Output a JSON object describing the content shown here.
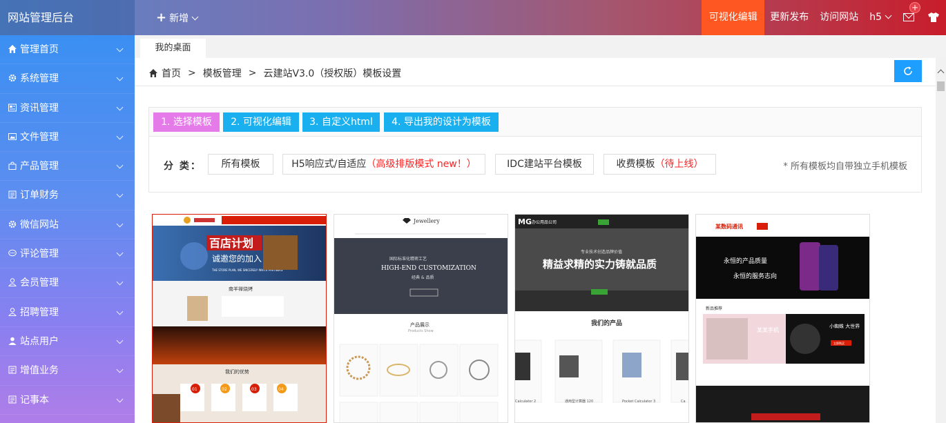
{
  "brand": "网站管理后台",
  "topbar": {
    "new_label": "新增",
    "visual_edit": "可视化编辑",
    "publish": "更新发布",
    "visit": "访问网站",
    "h5": "h5",
    "mail_badge": "+"
  },
  "sidebar": {
    "items": [
      {
        "label": "管理首页",
        "icon": "home-icon"
      },
      {
        "label": "系统管理",
        "icon": "gear-icon"
      },
      {
        "label": "资讯管理",
        "icon": "news-icon"
      },
      {
        "label": "文件管理",
        "icon": "image-icon"
      },
      {
        "label": "产品管理",
        "icon": "bag-icon"
      },
      {
        "label": "订单财务",
        "icon": "order-icon"
      },
      {
        "label": "微信网站",
        "icon": "gear-icon"
      },
      {
        "label": "评论管理",
        "icon": "comment-icon"
      },
      {
        "label": "会员管理",
        "icon": "user-icon"
      },
      {
        "label": "招聘管理",
        "icon": "user-icon"
      },
      {
        "label": "站点用户",
        "icon": "person-icon"
      },
      {
        "label": "增值业务",
        "icon": "order-icon"
      },
      {
        "label": "记事本",
        "icon": "order-icon"
      }
    ]
  },
  "tabs": {
    "desktop": "我的桌面"
  },
  "breadcrumb": {
    "home": "首页",
    "sep": ">",
    "level1": "模板管理",
    "level2": "云建站V3.0（授权版）模板设置"
  },
  "steps": {
    "s1": "1. 选择模板",
    "s2": "2. 可视化编辑",
    "s3": "3. 自定义html",
    "s4": "4. 导出我的设计为模板"
  },
  "categories": {
    "label": "分 类：",
    "all": "所有模板",
    "h5": "H5响应式/自适应",
    "h5_note": "（高级排版模式 new！）",
    "idc": "IDC建站平台模板",
    "paid": "收费模板",
    "paid_note": "（待上线）",
    "note": "* 所有模板均自带独立手机模板"
  },
  "templates": [
    {
      "hero": "百店计划",
      "hero_sub": "诚邀您的加入",
      "hero_en": "THE STORE PLAN, WE SINCERELY INVITE PARTNERS",
      "section_title": "南羊禅烧烤",
      "section_title2": "我们的优势",
      "badges": [
        "01",
        "02",
        "03",
        "04"
      ]
    },
    {
      "brand": "Jewellery",
      "hero_cn": "国际标准化精密工艺",
      "hero_en": "HIGH-END CUSTOMIZATION",
      "hero_sub": "经典 & 品质",
      "section_title": "产品展示",
      "section_sub": "Products Show"
    },
    {
      "brand": "MG",
      "brand_name": "办公用品公司",
      "hero_small": "专业技术创造品牌价值",
      "hero": "精益求精的实力铸就品质",
      "section_title": "我们的产品",
      "captions": [
        "Calculator 2",
        "通用型计算器 120",
        "Pocket Calculator 3",
        "Ca"
      ]
    },
    {
      "brand": "某数码通讯",
      "hero_line1": "永恒的产品质量",
      "hero_line2": "永恒的服务志向",
      "section_title": "新品推荐",
      "promo1": "某某手机",
      "promo2": "小蜘蛛 大世界",
      "promo_btn": "立即购买"
    }
  ],
  "colors": {
    "accent_orange": "#ff5722",
    "step_active": "#e57be8",
    "step_blue": "#1ab0f0",
    "refresh_blue": "#1e9fff",
    "note_red": "#ff2222"
  }
}
